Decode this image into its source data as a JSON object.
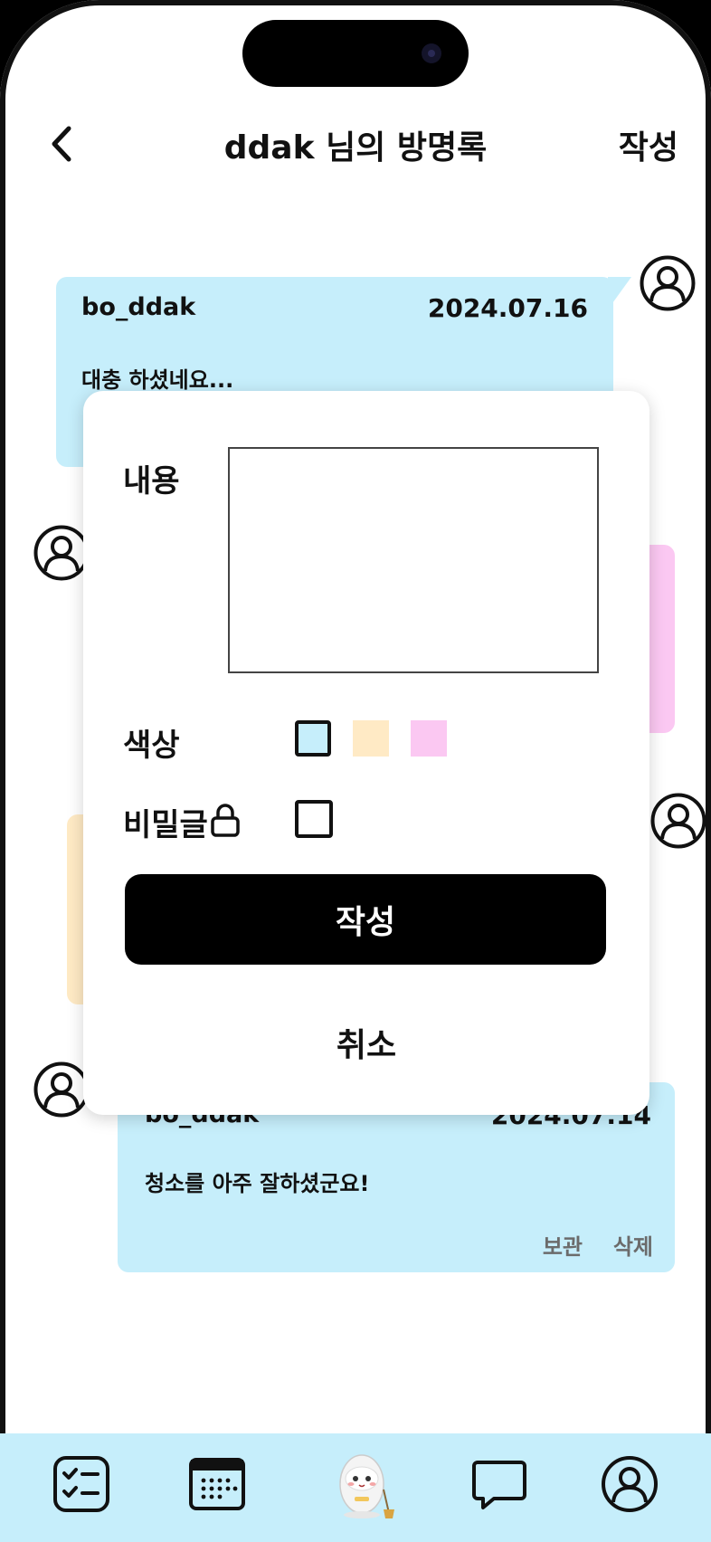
{
  "header": {
    "title": "ddak 님의 방명록",
    "write_label": "작성"
  },
  "cards": [
    {
      "user": "bo_ddak",
      "date": "2024.07.16",
      "message": "대충 하셨네요..."
    },
    {
      "user": "bo_ddak",
      "date": "2024.07.14",
      "message": "청소를 아주 잘하셨군요!",
      "archive": "보관",
      "delete": "삭제"
    }
  ],
  "modal": {
    "content_label": "내용",
    "content_value": "",
    "color_label": "색상",
    "secret_label": "비밀글",
    "submit_label": "작성",
    "cancel_label": "취소",
    "colors": [
      "#c6eefb",
      "#ffeac5",
      "#fbc8f2"
    ],
    "selected_color_index": 0
  },
  "tabs": [
    "checklist-icon",
    "calendar-icon",
    "mascot-home",
    "chat-icon",
    "profile-icon"
  ]
}
